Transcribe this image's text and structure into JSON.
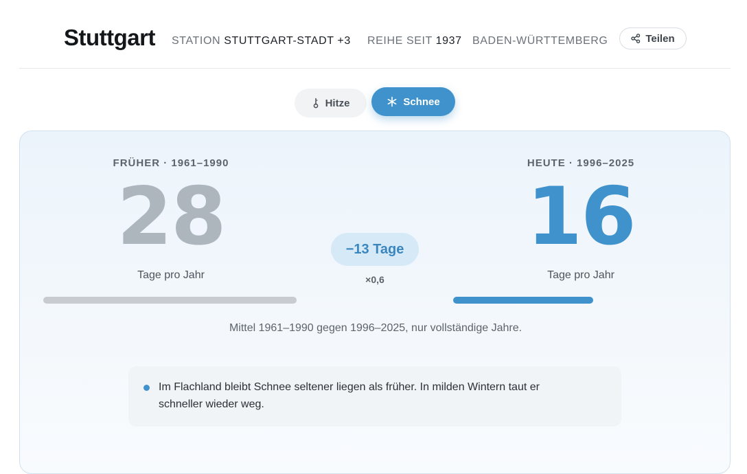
{
  "header": {
    "city": "Stuttgart",
    "station_label": "STATION",
    "station_value": "STUTTGART-STADT +3",
    "series_label": "REIHE SEIT",
    "series_value": "1937",
    "region": "BADEN-WÜRTTEMBERG",
    "share_label": "Teilen"
  },
  "tabs": [
    {
      "label": "Hitze",
      "icon": "thermometer-icon",
      "active": false
    },
    {
      "label": "Schnee",
      "icon": "snowflake-icon",
      "active": true
    }
  ],
  "comparison": {
    "before": {
      "period": "FRÜHER · 1961–1990",
      "value": "28",
      "unit": "Tage pro Jahr",
      "bar_fraction": 1.0
    },
    "after": {
      "period": "HEUTE · 1996–2025",
      "value": "16",
      "unit": "Tage pro Jahr",
      "bar_fraction": 0.55
    },
    "difference": "−13 Tage",
    "factor": "×0,6",
    "note": "Mittel 1961–1990 gegen 1996–2025, nur vollständige Jahre."
  },
  "insight": {
    "text": "Im Flachland bleibt Schnee seltener liegen als früher. In milden Wintern taut er schneller wieder weg."
  },
  "colors": {
    "accent": "#3f92cc",
    "muted_number": "#adb5bd",
    "bar_muted": "#c8ccd0"
  }
}
